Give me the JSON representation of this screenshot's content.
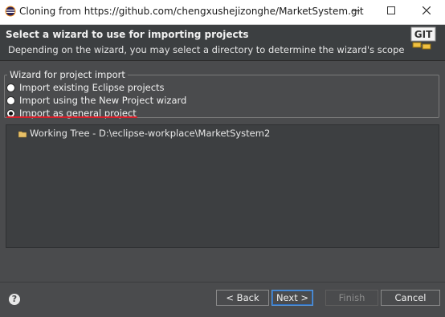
{
  "window": {
    "title": "Cloning from https://github.com/chengxushejizonghe/MarketSystem.git"
  },
  "header": {
    "title": "Select a wizard to use for importing projects",
    "description": "Depending on the wizard, you may select a directory to determine the wizard's scope",
    "logo_text": "GIT"
  },
  "wizard_group": {
    "label": "Wizard for project import",
    "options": [
      {
        "label": "Import existing Eclipse projects",
        "selected": false
      },
      {
        "label": "Import using the New Project wizard",
        "selected": false
      },
      {
        "label": "Import as general project",
        "selected": true
      }
    ]
  },
  "tree": {
    "items": [
      {
        "label": "Working Tree - D:\\eclipse-workplace\\MarketSystem2",
        "icon": "folder-icon"
      }
    ]
  },
  "buttons": {
    "back": "< Back",
    "next": "Next >",
    "finish": "Finish",
    "cancel": "Cancel"
  },
  "colors": {
    "accent": "#5a9be0",
    "annotation_underline": "#d7202b"
  }
}
